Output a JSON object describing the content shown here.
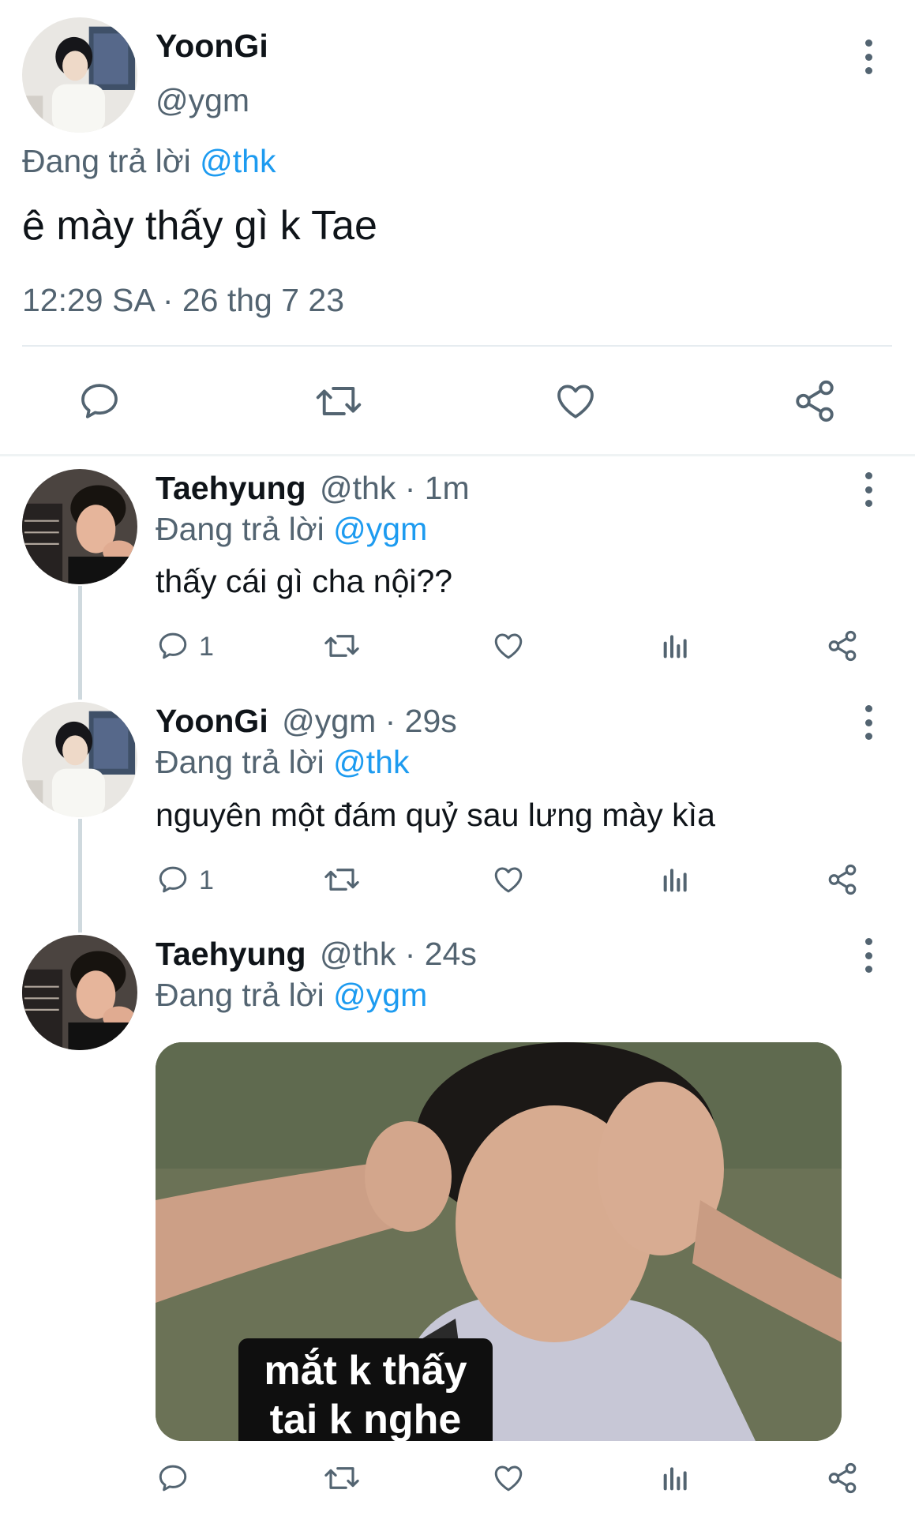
{
  "main_tweet": {
    "display_name": "YoonGi",
    "handle": "@ygm",
    "replying_prefix": "Đang trả lời",
    "replying_to": "@thk",
    "text": "ê mày thấy gì k Tae",
    "timestamp": "12:29 SA · 26 thg 7 23",
    "actions": [
      "reply-icon",
      "retweet-icon",
      "like-icon",
      "share-icon"
    ]
  },
  "replies": [
    {
      "display_name": "Taehyung",
      "meta": "@thk · 1m",
      "replying_prefix": "Đang trả lời",
      "replying_to": "@ygm",
      "text": "thấy cái gì cha nội??",
      "reply_count": "1"
    },
    {
      "display_name": "YoonGi",
      "meta": "@ygm · 29s",
      "replying_prefix": "Đang trả lời",
      "replying_to": "@thk",
      "text": "nguyên một đám quỷ sau lưng mày kìa",
      "reply_count": "1"
    },
    {
      "display_name": "Taehyung",
      "meta": "@thk · 24s",
      "replying_prefix": "Đang trả lời",
      "replying_to": "@ygm",
      "media_caption_line1": "mắt k thấy",
      "media_caption_line2": "tai k nghe"
    }
  ],
  "colors": {
    "link": "#1d9bf0",
    "muted": "#536471",
    "text": "#0f1419",
    "divider": "#e6ecf0"
  }
}
